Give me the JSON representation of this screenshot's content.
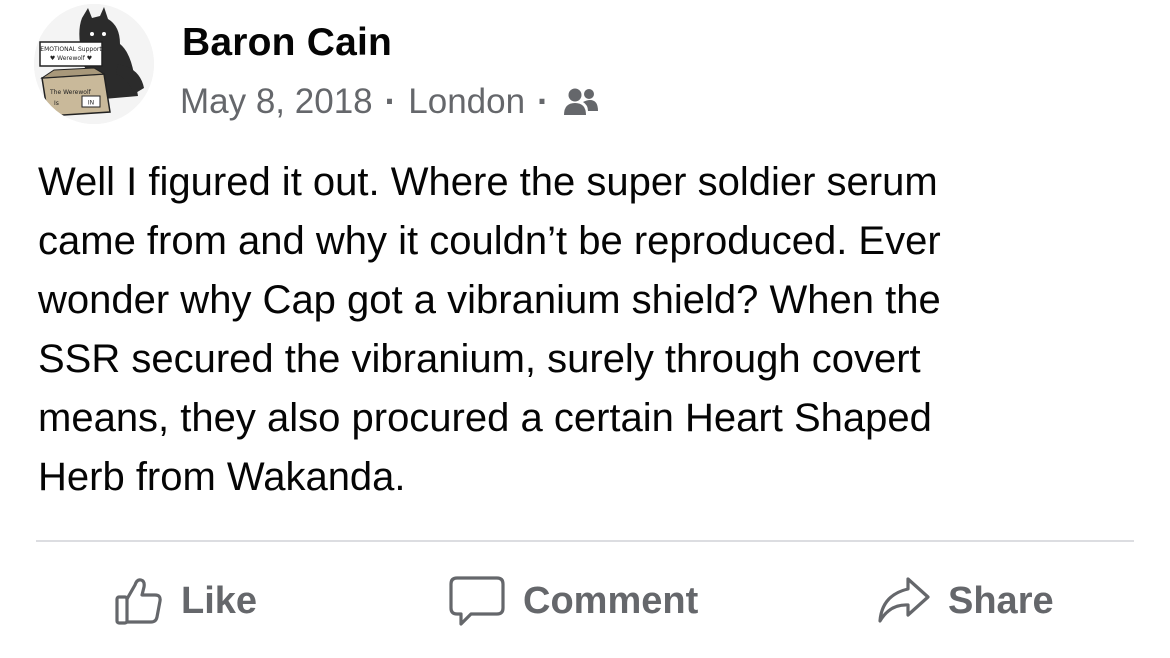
{
  "post": {
    "author": "Baron Cain",
    "date": "May 8, 2018",
    "location": "London",
    "audience_icon": "friends-icon",
    "separator": "·",
    "text": "Well I figured it out. Where the super soldier serum\ncame from and why it couldn’t be reproduced. Ever\nwonder why Cap got a vibranium shield? When the\nSSR secured the vibranium, surely through covert\nmeans, they also procured a certain Heart Shaped\nHerb from Wakanda."
  },
  "avatar": {
    "sign_line1": "EMOTIONAL Support",
    "sign_line2": "♥ Werewolf ♥",
    "box_line1": "The Werewolf",
    "box_line2": "Is",
    "box_tag": "IN"
  },
  "actions": {
    "like_label": "Like",
    "comment_label": "Comment",
    "share_label": "Share"
  },
  "colors": {
    "text_primary": "#050505",
    "text_secondary": "#65676b",
    "divider": "#dcdde1",
    "background": "#ffffff"
  }
}
